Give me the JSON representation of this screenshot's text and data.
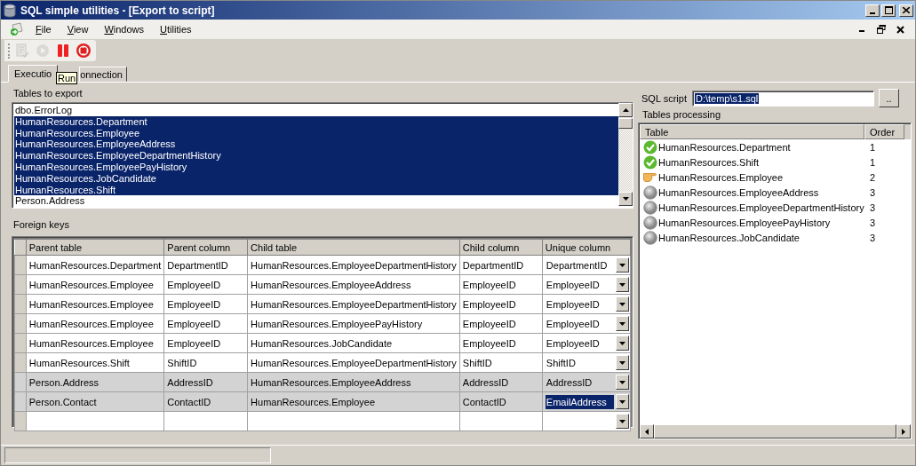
{
  "window": {
    "title": "SQL simple utilities - [Export to script]"
  },
  "menu": [
    {
      "label": "File"
    },
    {
      "label": "View"
    },
    {
      "label": "Windows"
    },
    {
      "label": "Utilities"
    }
  ],
  "toolbar": [
    {
      "kind": "script",
      "disabled": true
    },
    {
      "kind": "run",
      "disabled": true
    },
    {
      "kind": "pause",
      "disabled": false
    },
    {
      "kind": "stop",
      "disabled": false
    }
  ],
  "tabs": [
    {
      "label": "Executio",
      "selected": true
    },
    {
      "label": "onnection",
      "selected": false
    }
  ],
  "tooltip": {
    "text": "Run"
  },
  "tables_to_export": {
    "label": "Tables to export",
    "items": [
      {
        "name": "dbo.ErrorLog",
        "selected": false
      },
      {
        "name": "HumanResources.Department",
        "selected": true
      },
      {
        "name": "HumanResources.Employee",
        "selected": true
      },
      {
        "name": "HumanResources.EmployeeAddress",
        "selected": true
      },
      {
        "name": "HumanResources.EmployeeDepartmentHistory",
        "selected": true
      },
      {
        "name": "HumanResources.EmployeePayHistory",
        "selected": true
      },
      {
        "name": "HumanResources.JobCandidate",
        "selected": true
      },
      {
        "name": "HumanResources.Shift",
        "selected": true
      },
      {
        "name": "Person.Address",
        "selected": false
      }
    ]
  },
  "foreign_keys": {
    "label": "Foreign keys",
    "columns": [
      "Parent table",
      "Parent column",
      "Child table",
      "Child column",
      "Unique column"
    ],
    "rows": [
      {
        "cells": [
          "HumanResources.Department",
          "DepartmentID",
          "HumanResources.EmployeeDepartmentHistory",
          "DepartmentID"
        ],
        "unique": {
          "value": "DepartmentID",
          "selected": false
        },
        "grayed": false
      },
      {
        "cells": [
          "HumanResources.Employee",
          "EmployeeID",
          "HumanResources.EmployeeAddress",
          "EmployeeID"
        ],
        "unique": {
          "value": "EmployeeID",
          "selected": false
        },
        "grayed": false
      },
      {
        "cells": [
          "HumanResources.Employee",
          "EmployeeID",
          "HumanResources.EmployeeDepartmentHistory",
          "EmployeeID"
        ],
        "unique": {
          "value": "EmployeeID",
          "selected": false
        },
        "grayed": false
      },
      {
        "cells": [
          "HumanResources.Employee",
          "EmployeeID",
          "HumanResources.EmployeePayHistory",
          "EmployeeID"
        ],
        "unique": {
          "value": "EmployeeID",
          "selected": false
        },
        "grayed": false
      },
      {
        "cells": [
          "HumanResources.Employee",
          "EmployeeID",
          "HumanResources.JobCandidate",
          "EmployeeID"
        ],
        "unique": {
          "value": "EmployeeID",
          "selected": false
        },
        "grayed": false
      },
      {
        "cells": [
          "HumanResources.Shift",
          "ShiftID",
          "HumanResources.EmployeeDepartmentHistory",
          "ShiftID"
        ],
        "unique": {
          "value": "ShiftID",
          "selected": false
        },
        "grayed": false
      },
      {
        "cells": [
          "Person.Address",
          "AddressID",
          "HumanResources.EmployeeAddress",
          "AddressID"
        ],
        "unique": {
          "value": "AddressID",
          "selected": false
        },
        "grayed": true
      },
      {
        "cells": [
          "Person.Contact",
          "ContactID",
          "HumanResources.Employee",
          "ContactID"
        ],
        "unique": {
          "value": "EmailAddress",
          "selected": true
        },
        "grayed": true
      }
    ]
  },
  "sql_script": {
    "label": "SQL script",
    "value": "D:\\temp\\s1.sql",
    "browse_button": ".."
  },
  "tables_processing": {
    "label": "Tables processing",
    "columns": [
      "Table",
      "Order"
    ],
    "rows": [
      {
        "table": "HumanResources.Department",
        "order": "1",
        "kind": "done"
      },
      {
        "table": "HumanResources.Shift",
        "order": "1",
        "kind": "done"
      },
      {
        "table": "HumanResources.Employee",
        "order": "2",
        "kind": "current"
      },
      {
        "table": "HumanResources.EmployeeAddress",
        "order": "3",
        "kind": "pending"
      },
      {
        "table": "HumanResources.EmployeeDepartmentHistory",
        "order": "3",
        "kind": "pending"
      },
      {
        "table": "HumanResources.EmployeePayHistory",
        "order": "3",
        "kind": "pending"
      },
      {
        "table": "HumanResources.JobCandidate",
        "order": "3",
        "kind": "pending"
      }
    ]
  }
}
